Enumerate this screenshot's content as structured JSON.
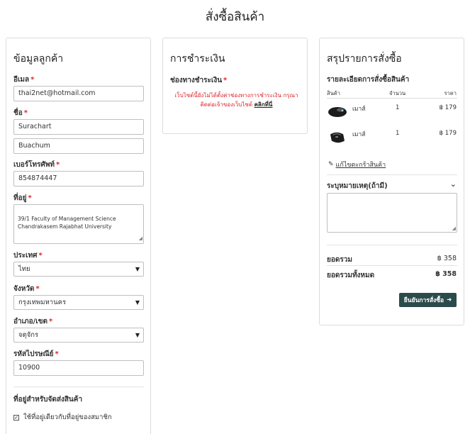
{
  "page": {
    "title": "สั่งซื้อสินค้า"
  },
  "customer": {
    "title": "ข้อมูลลูกค้า",
    "email_label": "อีเมล",
    "email_value": "thai2net@hotmail.com",
    "name_label": "ชื่อ",
    "first_name_value": "Surachart",
    "last_name_value": "Buachum",
    "phone_label": "เบอร์โทรศัพท์",
    "phone_value": "854874447",
    "address_label": "ที่อยู่",
    "address_value": "39/1 Faculty of Management Science\nChandrakasem Rajabhat University",
    "country_label": "ประเทศ",
    "country_value": "ไทย",
    "province_label": "จังหวัด",
    "province_value": "กรุงเทพมหานคร",
    "district_label": "อำเภอ/เขต",
    "district_value": "จตุจักร",
    "postcode_label": "รหัสไปรษณีย์",
    "postcode_value": "10900",
    "shipping_title": "ที่อยู่สำหรับจัดส่งสินค้า",
    "same_address_label": "ใช้ที่อยู่เดียวกับที่อยู่ของสมาชิก",
    "required_mark": "*"
  },
  "payment": {
    "title": "การชำระเงิน",
    "channel_label": "ช่องทางชำระเงิน",
    "message": "เว็บไซต์นี้ยังไม่ได้ตั้งค่าช่องทางการชำระเงิน กรุณาติดต่อเจ้าของเว็บไซต์",
    "link_text": "คลิกที่นี่"
  },
  "summary": {
    "title": "สรุปรายการสั่งซื้อ",
    "details_label": "รายละเอียดการสั่งซื้อสินค้า",
    "col_product": "สินค้า",
    "col_qty": "จำนวน",
    "col_price": "ราคา",
    "items": [
      {
        "name": "เมาส์",
        "qty": "1",
        "price": "฿ 179",
        "icon": "mouse-icon"
      },
      {
        "name": "เมาส์",
        "qty": "1",
        "price": "฿ 179",
        "icon": "mouse-icon"
      }
    ],
    "edit_cart": "แก้ไขตะกร้าสินค้า",
    "note_label": "ระบุหมายเหตุ(ถ้ามี)",
    "subtotal_label": "ยอดรวม",
    "subtotal_value": "฿ 358",
    "total_label": "ยอดรวมทั้งหมด",
    "total_value": "฿ 358",
    "confirm_label": "ยืนยันการสั่งซื้อ"
  },
  "colors": {
    "accent_button": "#2b4a4c",
    "required": "#d9262c"
  }
}
